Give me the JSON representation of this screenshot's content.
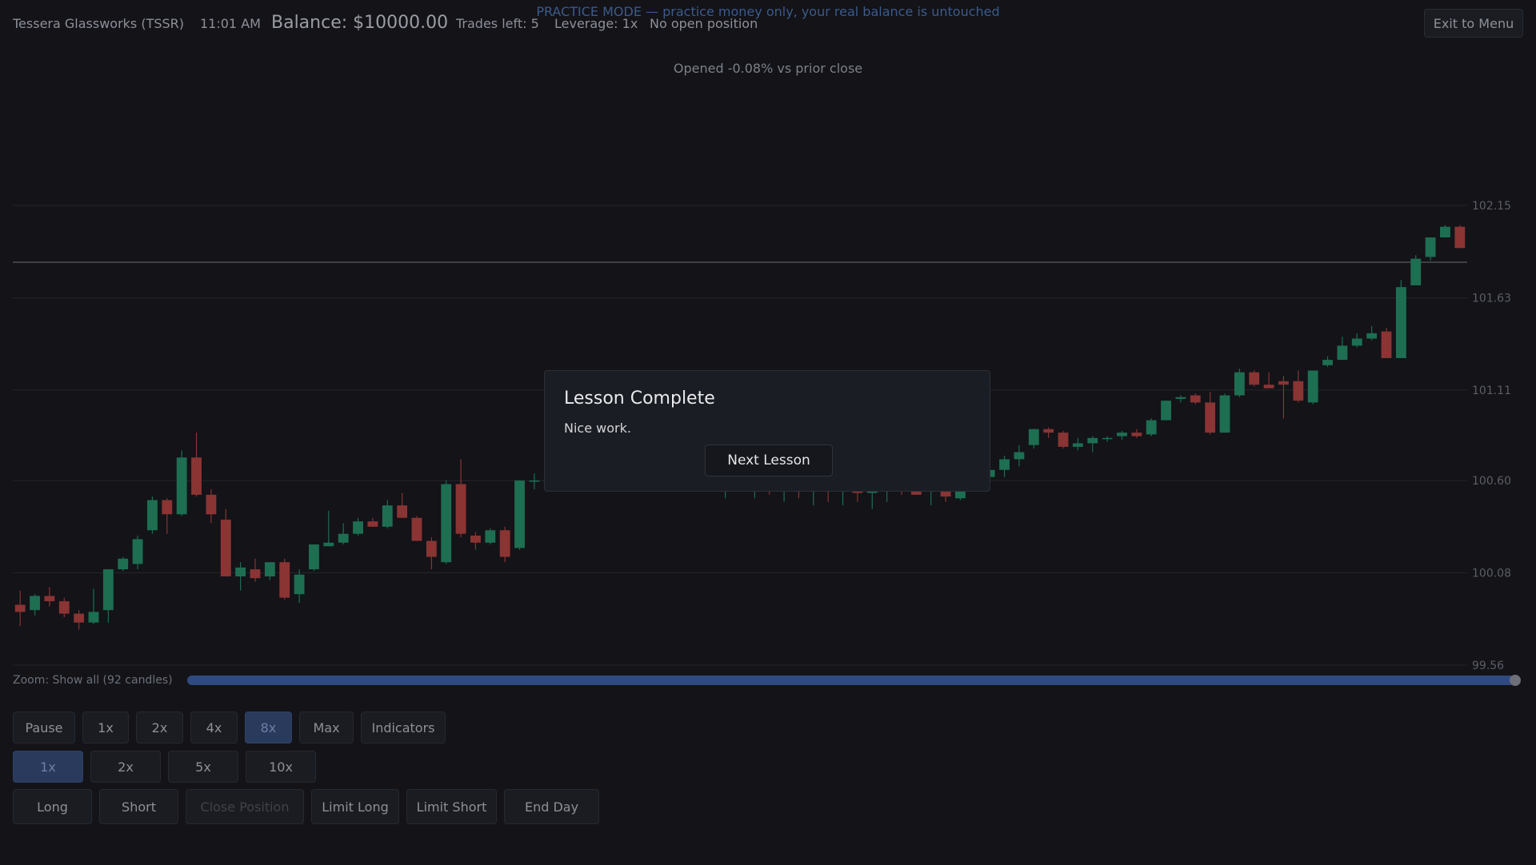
{
  "header": {
    "practice_banner": "PRACTICE MODE — practice money only, your real balance is untouched",
    "ticker": "Tessera Glassworks (TSSR)",
    "time": "11:01 AM",
    "balance": "Balance: $10000.00",
    "trades_left": "Trades left: 5",
    "leverage": "Leverage: 1x",
    "position": "No open position",
    "exit_label": "Exit to Menu"
  },
  "market_note": "Opened -0.08% vs prior close",
  "zoom": {
    "label": "Zoom: Show all (92 candles)",
    "fraction": 1.0
  },
  "speed_buttons": [
    {
      "label": "Pause",
      "active": false
    },
    {
      "label": "1x",
      "active": false
    },
    {
      "label": "2x",
      "active": false
    },
    {
      "label": "4x",
      "active": false
    },
    {
      "label": "8x",
      "active": true
    },
    {
      "label": "Max",
      "active": false
    },
    {
      "label": "Indicators",
      "active": false
    }
  ],
  "leverage_buttons": [
    {
      "label": "1x",
      "active": true
    },
    {
      "label": "2x",
      "active": false
    },
    {
      "label": "5x",
      "active": false
    },
    {
      "label": "10x",
      "active": false
    }
  ],
  "trade_buttons": [
    {
      "label": "Long",
      "disabled": false
    },
    {
      "label": "Short",
      "disabled": false
    },
    {
      "label": "Close Position",
      "disabled": true
    },
    {
      "label": "Limit Long",
      "disabled": false
    },
    {
      "label": "Limit Short",
      "disabled": false
    },
    {
      "label": "End Day",
      "disabled": false
    }
  ],
  "modal": {
    "title": "Lesson Complete",
    "message": "Nice work.",
    "button_label": "Next Lesson"
  },
  "colors": {
    "up": "#1e6e52",
    "down": "#8a3434",
    "accent": "#2e4a7e",
    "grid": "#24262c",
    "prev_close_line": "#6a6c70"
  },
  "chart_data": {
    "type": "candlestick",
    "ylim": [
      99.56,
      102.15
    ],
    "price_ticks": [
      102.15,
      101.63,
      101.11,
      100.6,
      100.08,
      99.56
    ],
    "reference_line": 101.83,
    "candles": [
      {
        "o": 99.9,
        "h": 99.98,
        "l": 99.78,
        "c": 99.86
      },
      {
        "o": 99.87,
        "h": 99.96,
        "l": 99.84,
        "c": 99.95
      },
      {
        "o": 99.95,
        "h": 100.0,
        "l": 99.89,
        "c": 99.92
      },
      {
        "o": 99.92,
        "h": 99.94,
        "l": 99.83,
        "c": 99.85
      },
      {
        "o": 99.85,
        "h": 99.87,
        "l": 99.76,
        "c": 99.8
      },
      {
        "o": 99.8,
        "h": 99.99,
        "l": 99.79,
        "c": 99.86
      },
      {
        "o": 99.87,
        "h": 100.1,
        "l": 99.8,
        "c": 100.1
      },
      {
        "o": 100.1,
        "h": 100.17,
        "l": 100.09,
        "c": 100.16
      },
      {
        "o": 100.13,
        "h": 100.29,
        "l": 100.1,
        "c": 100.27
      },
      {
        "o": 100.32,
        "h": 100.51,
        "l": 100.3,
        "c": 100.49
      },
      {
        "o": 100.49,
        "h": 100.5,
        "l": 100.3,
        "c": 100.41
      },
      {
        "o": 100.41,
        "h": 100.77,
        "l": 100.4,
        "c": 100.73
      },
      {
        "o": 100.73,
        "h": 100.87,
        "l": 100.51,
        "c": 100.52
      },
      {
        "o": 100.52,
        "h": 100.55,
        "l": 100.36,
        "c": 100.41
      },
      {
        "o": 100.38,
        "h": 100.44,
        "l": 100.06,
        "c": 100.06
      },
      {
        "o": 100.06,
        "h": 100.14,
        "l": 99.98,
        "c": 100.11
      },
      {
        "o": 100.1,
        "h": 100.16,
        "l": 100.03,
        "c": 100.05
      },
      {
        "o": 100.06,
        "h": 100.14,
        "l": 100.04,
        "c": 100.14
      },
      {
        "o": 100.14,
        "h": 100.16,
        "l": 99.93,
        "c": 99.94
      },
      {
        "o": 99.96,
        "h": 100.1,
        "l": 99.91,
        "c": 100.07
      },
      {
        "o": 100.1,
        "h": 100.24,
        "l": 100.09,
        "c": 100.24
      },
      {
        "o": 100.23,
        "h": 100.43,
        "l": 100.23,
        "c": 100.25
      },
      {
        "o": 100.25,
        "h": 100.36,
        "l": 100.24,
        "c": 100.3
      },
      {
        "o": 100.3,
        "h": 100.39,
        "l": 100.29,
        "c": 100.37
      },
      {
        "o": 100.37,
        "h": 100.39,
        "l": 100.34,
        "c": 100.34
      },
      {
        "o": 100.34,
        "h": 100.49,
        "l": 100.33,
        "c": 100.46
      },
      {
        "o": 100.46,
        "h": 100.53,
        "l": 100.39,
        "c": 100.39
      },
      {
        "o": 100.39,
        "h": 100.4,
        "l": 100.26,
        "c": 100.26
      },
      {
        "o": 100.26,
        "h": 100.28,
        "l": 100.1,
        "c": 100.17
      },
      {
        "o": 100.14,
        "h": 100.6,
        "l": 100.13,
        "c": 100.58
      },
      {
        "o": 100.58,
        "h": 100.72,
        "l": 100.28,
        "c": 100.3
      },
      {
        "o": 100.29,
        "h": 100.31,
        "l": 100.21,
        "c": 100.25
      },
      {
        "o": 100.25,
        "h": 100.33,
        "l": 100.24,
        "c": 100.32
      },
      {
        "o": 100.32,
        "h": 100.34,
        "l": 100.14,
        "c": 100.17
      },
      {
        "o": 100.22,
        "h": 100.6,
        "l": 100.21,
        "c": 100.6
      },
      {
        "o": 100.6,
        "h": 100.64,
        "l": 100.55,
        "c": 100.6
      },
      {
        "o": 100.6,
        "h": 100.64,
        "l": 100.54,
        "c": 100.6
      },
      {
        "o": 100.6,
        "h": 100.68,
        "l": 100.55,
        "c": 100.64
      },
      {
        "o": 100.64,
        "h": 100.7,
        "l": 100.58,
        "c": 100.62
      },
      {
        "o": 100.62,
        "h": 100.7,
        "l": 100.56,
        "c": 100.66
      },
      {
        "o": 100.66,
        "h": 100.72,
        "l": 100.6,
        "c": 100.61
      },
      {
        "o": 100.61,
        "h": 100.68,
        "l": 100.55,
        "c": 100.63
      },
      {
        "o": 100.63,
        "h": 100.7,
        "l": 100.57,
        "c": 100.67
      },
      {
        "o": 100.67,
        "h": 100.73,
        "l": 100.6,
        "c": 100.62
      },
      {
        "o": 100.62,
        "h": 100.7,
        "l": 100.56,
        "c": 100.65
      },
      {
        "o": 100.65,
        "h": 100.71,
        "l": 100.58,
        "c": 100.6
      },
      {
        "o": 100.6,
        "h": 100.68,
        "l": 100.54,
        "c": 100.63
      },
      {
        "o": 100.63,
        "h": 100.7,
        "l": 100.56,
        "c": 100.58
      },
      {
        "o": 100.58,
        "h": 100.66,
        "l": 100.5,
        "c": 100.62
      },
      {
        "o": 100.62,
        "h": 100.68,
        "l": 100.54,
        "c": 100.57
      },
      {
        "o": 100.57,
        "h": 100.64,
        "l": 100.5,
        "c": 100.6
      },
      {
        "o": 100.6,
        "h": 100.66,
        "l": 100.52,
        "c": 100.56
      },
      {
        "o": 100.56,
        "h": 100.62,
        "l": 100.48,
        "c": 100.59
      },
      {
        "o": 100.59,
        "h": 100.64,
        "l": 100.5,
        "c": 100.55
      },
      {
        "o": 100.55,
        "h": 100.6,
        "l": 100.46,
        "c": 100.58
      },
      {
        "o": 100.58,
        "h": 100.62,
        "l": 100.48,
        "c": 100.54
      },
      {
        "o": 100.54,
        "h": 100.6,
        "l": 100.46,
        "c": 100.57
      },
      {
        "o": 100.57,
        "h": 100.62,
        "l": 100.48,
        "c": 100.53
      },
      {
        "o": 100.53,
        "h": 100.58,
        "l": 100.44,
        "c": 100.56
      },
      {
        "o": 100.56,
        "h": 100.62,
        "l": 100.48,
        "c": 100.6
      },
      {
        "o": 100.6,
        "h": 100.64,
        "l": 100.52,
        "c": 100.56
      },
      {
        "o": 100.56,
        "h": 100.57,
        "l": 100.52,
        "c": 100.52
      },
      {
        "o": 100.55,
        "h": 100.56,
        "l": 100.46,
        "c": 100.55
      },
      {
        "o": 100.55,
        "h": 100.56,
        "l": 100.48,
        "c": 100.51
      },
      {
        "o": 100.5,
        "h": 100.58,
        "l": 100.49,
        "c": 100.57
      },
      {
        "o": 100.57,
        "h": 100.64,
        "l": 100.54,
        "c": 100.62
      },
      {
        "o": 100.62,
        "h": 100.7,
        "l": 100.58,
        "c": 100.66
      },
      {
        "o": 100.66,
        "h": 100.74,
        "l": 100.62,
        "c": 100.72
      },
      {
        "o": 100.72,
        "h": 100.8,
        "l": 100.68,
        "c": 100.76
      },
      {
        "o": 100.8,
        "h": 100.89,
        "l": 100.78,
        "c": 100.89
      },
      {
        "o": 100.89,
        "h": 100.9,
        "l": 100.84,
        "c": 100.87
      },
      {
        "o": 100.87,
        "h": 100.88,
        "l": 100.78,
        "c": 100.79
      },
      {
        "o": 100.79,
        "h": 100.84,
        "l": 100.77,
        "c": 100.81
      },
      {
        "o": 100.81,
        "h": 100.85,
        "l": 100.76,
        "c": 100.84
      },
      {
        "o": 100.84,
        "h": 100.85,
        "l": 100.82,
        "c": 100.84
      },
      {
        "o": 100.85,
        "h": 100.88,
        "l": 100.83,
        "c": 100.87
      },
      {
        "o": 100.87,
        "h": 100.89,
        "l": 100.84,
        "c": 100.85
      },
      {
        "o": 100.86,
        "h": 100.95,
        "l": 100.85,
        "c": 100.94
      },
      {
        "o": 100.94,
        "h": 101.05,
        "l": 100.94,
        "c": 101.05
      },
      {
        "o": 101.06,
        "h": 101.08,
        "l": 101.04,
        "c": 101.07
      },
      {
        "o": 101.08,
        "h": 101.09,
        "l": 101.03,
        "c": 101.04
      },
      {
        "o": 101.04,
        "h": 101.1,
        "l": 100.86,
        "c": 100.87
      },
      {
        "o": 100.87,
        "h": 101.09,
        "l": 100.87,
        "c": 101.08
      },
      {
        "o": 101.08,
        "h": 101.23,
        "l": 101.07,
        "c": 101.21
      },
      {
        "o": 101.21,
        "h": 101.22,
        "l": 101.13,
        "c": 101.14
      },
      {
        "o": 101.14,
        "h": 101.21,
        "l": 101.13,
        "c": 101.12
      },
      {
        "o": 101.16,
        "h": 101.19,
        "l": 100.95,
        "c": 101.14
      },
      {
        "o": 101.16,
        "h": 101.22,
        "l": 101.04,
        "c": 101.05
      },
      {
        "o": 101.04,
        "h": 101.22,
        "l": 101.03,
        "c": 101.22
      },
      {
        "o": 101.25,
        "h": 101.3,
        "l": 101.24,
        "c": 101.28
      },
      {
        "o": 101.28,
        "h": 101.41,
        "l": 101.28,
        "c": 101.36
      },
      {
        "o": 101.36,
        "h": 101.43,
        "l": 101.35,
        "c": 101.4
      },
      {
        "o": 101.4,
        "h": 101.47,
        "l": 101.39,
        "c": 101.43
      },
      {
        "o": 101.44,
        "h": 101.46,
        "l": 101.29,
        "c": 101.29
      },
      {
        "o": 101.29,
        "h": 101.73,
        "l": 101.29,
        "c": 101.69
      },
      {
        "o": 101.7,
        "h": 101.87,
        "l": 101.7,
        "c": 101.85
      },
      {
        "o": 101.86,
        "h": 101.97,
        "l": 101.84,
        "c": 101.97
      },
      {
        "o": 101.97,
        "h": 102.04,
        "l": 101.97,
        "c": 102.03
      },
      {
        "o": 102.03,
        "h": 102.04,
        "l": 101.91,
        "c": 101.91
      }
    ]
  }
}
